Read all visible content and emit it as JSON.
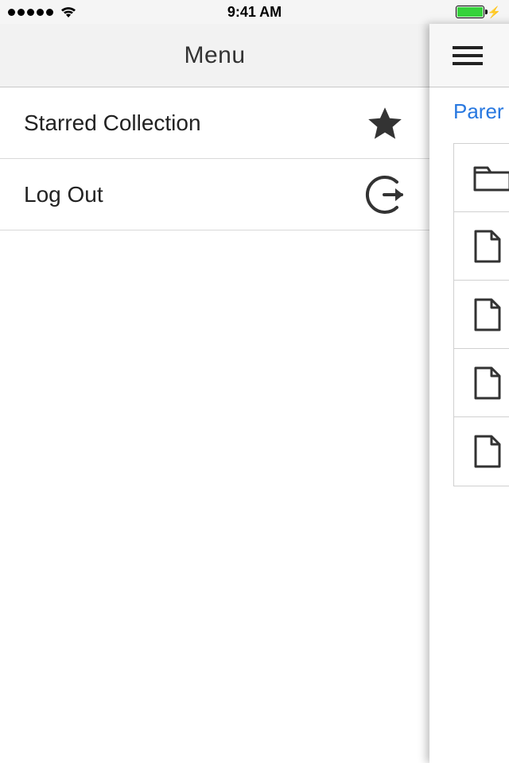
{
  "status": {
    "time": "9:41 AM"
  },
  "menu": {
    "title": "Menu",
    "items": [
      {
        "label": "Starred Collection",
        "icon": "star-icon"
      },
      {
        "label": "Log Out",
        "icon": "logout-icon"
      }
    ]
  },
  "under": {
    "breadcrumb": "Parer",
    "rows": [
      {
        "icon": "folder-icon"
      },
      {
        "icon": "file-icon"
      },
      {
        "icon": "file-icon"
      },
      {
        "icon": "file-icon"
      },
      {
        "icon": "file-icon"
      }
    ]
  }
}
